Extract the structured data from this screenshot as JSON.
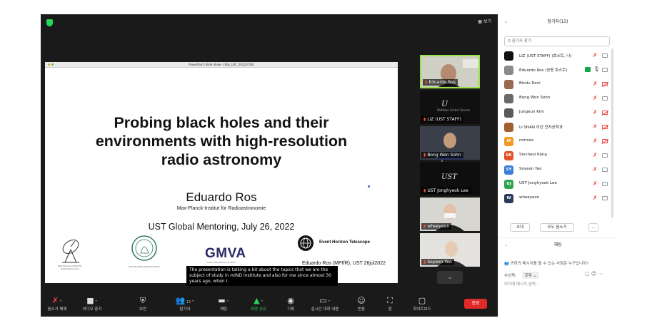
{
  "toolbar_top": {
    "view_label": "보기"
  },
  "share_window": {
    "title": "PowerPoint Slide Show - [Ros_UST_20220726]"
  },
  "slide": {
    "title": "Probing black holes and their environments with high-resolution radio astronomy",
    "author": "Eduardo Ros",
    "institute": "Max-Planck-Institut für Radioastronomie",
    "event": "UST Global Mentoring, July 26, 2022",
    "logo_mpifr_caption": "Max-Planck-Institut für Radioastronomie",
    "logo_mpg_caption": "MAX-PLANCK-GESELLSCHAFT",
    "gmva": "GMVA",
    "gmva_caption": "GLOBAL MILLIMETER VLBI ARRAY",
    "eht": "Event Horizon Telescope",
    "footer": "Eduardo Ros (MPIfR), UST 26jul2022"
  },
  "caption": "The presentation is talking a bit about the topics that we are the subject of study in mIND Institute and also for me since almost 30 years ago, when I.",
  "gallery": [
    {
      "name": "Eduardo Ros",
      "active": true
    },
    {
      "name": "LIZ (UST STAFF)"
    },
    {
      "name": "Bong Won Sohn"
    },
    {
      "name": "UST Jonghyeok Lee"
    },
    {
      "name": "wheeyeon"
    },
    {
      "name": "Soyeon Yeo"
    }
  ],
  "bottom_toolbar": {
    "mute": "음소거 해제",
    "video": "비디오 중지",
    "security": "보안",
    "participants": "참가자",
    "participants_count": "13",
    "chat": "채팅",
    "share": "화면 공유",
    "record": "기록",
    "cc": "실시간 대화 내용",
    "reactions": "반응",
    "apps": "앱",
    "whiteboard": "화이트보드",
    "end": "종료"
  },
  "panel": {
    "title": "참가자(13)",
    "search_placeholder": "참가자 찾기",
    "participants": [
      {
        "name": "LIZ (UST STAFF) (호스트, 나)",
        "initials": "",
        "color": "#111111",
        "camera": "on"
      },
      {
        "name": "Eduardo Ros (공동 호스트)",
        "initials": "",
        "color": "#8a8a8a",
        "camera": "on"
      },
      {
        "name": "Bindu Rani",
        "initials": "",
        "color": "#9a6a50",
        "camera": "off"
      },
      {
        "name": "Bong Won Sohn",
        "initials": "",
        "color": "#6a6a6a",
        "camera": "on"
      },
      {
        "name": "Jungeun Kim",
        "initials": "",
        "color": "#5a5a5a",
        "camera": "off"
      },
      {
        "name": "LI SHAN 이선 전자공학과",
        "initials": "",
        "color": "#a06030",
        "camera": "off"
      },
      {
        "name": "mimioo",
        "initials": "M",
        "color": "#f29a24",
        "camera": "off"
      },
      {
        "name": "Sincheol Kang",
        "initials": "SK",
        "color": "#e0532a",
        "camera": "on"
      },
      {
        "name": "Soyeon Yeo",
        "initials": "SY",
        "color": "#3b7fd9",
        "camera": "on"
      },
      {
        "name": "UST Jonghyeok Lee",
        "initials": "UJ",
        "color": "#2ea44f",
        "camera": "on"
      },
      {
        "name": "wheeyeon",
        "initials": "W",
        "color": "#2a3a5a",
        "camera": "on"
      }
    ],
    "invite": "초대",
    "mute_all": "모두 음소거",
    "more": "...",
    "chat_title": "채팅",
    "chat_info": "귀하의 메시지를 볼 수 있는 사람은 누구입니까?",
    "to_label": "수신자:",
    "to_value": "모두",
    "input_placeholder": "여기에 메시지 입력..."
  }
}
